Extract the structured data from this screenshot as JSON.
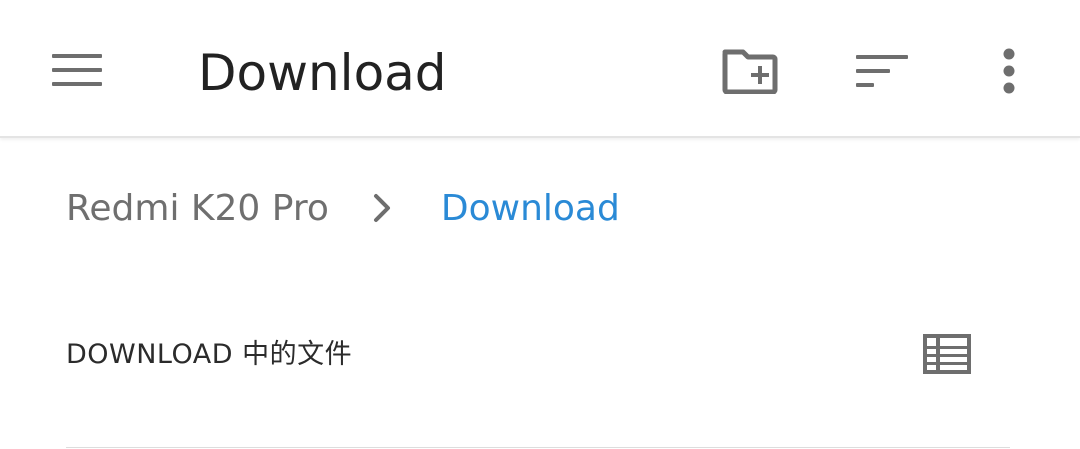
{
  "appbar": {
    "title": "Download",
    "menu_icon": "hamburger-menu-icon",
    "new_folder_icon": "create-folder-icon",
    "sort_icon": "sort-icon",
    "more_icon": "more-vertical-icon"
  },
  "breadcrumb": {
    "root": "Redmi K20 Pro",
    "separator_icon": "chevron-right-icon",
    "current": "Download"
  },
  "section": {
    "header": "DOWNLOAD 中的文件",
    "view_mode_icon": "list-view-icon"
  },
  "colors": {
    "title_text": "#222222",
    "icon_gray": "#6e6e6e",
    "breadcrumb_root": "#6f6f6f",
    "breadcrumb_active": "#2a8ad6",
    "divider": "#dddddd"
  }
}
